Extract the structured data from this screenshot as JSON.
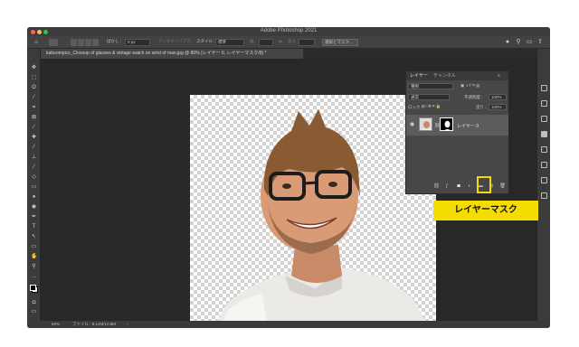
{
  "window": {
    "title": "Adobe Photoshop 2021"
  },
  "options_bar": {
    "feather_label": "ぼかし :",
    "feather_value": "0 px",
    "antialias_label": "アンチエイリアス",
    "style_label": "スタイル :",
    "style_value": "標準",
    "width_label": "幅 :",
    "height_label": "高さ :",
    "select_mask_label": "選択とマスク..."
  },
  "document": {
    "tab_label": "kaboompics_Closeup of glasses & vintage watch on wrist of man.jpg @ 80% (レイヤー 0, レイヤーマスク/8) *"
  },
  "status": {
    "zoom": "80%",
    "file_info": "ファイル : 8.14M/10.8M"
  },
  "layers_panel": {
    "tab_layers": "レイヤー",
    "tab_channels": "チャンネル",
    "filter_kind": "種類",
    "blend_mode": "通常",
    "opacity_label": "不透明度 :",
    "opacity_value": "100%",
    "lock_label": "ロック :",
    "fill_label": "塗り :",
    "fill_value": "100%",
    "layer_name": "レイヤー 0"
  },
  "annotation": {
    "label": "レイヤーマスク"
  },
  "colors": {
    "highlight": "#f5dc00",
    "panel_bg": "#474747",
    "canvas_bg": "#282828"
  },
  "icons": [
    "home-icon",
    "marquee-icon",
    "search-icon",
    "eye-icon",
    "mask-icon",
    "link-icon",
    "trash-icon"
  ]
}
